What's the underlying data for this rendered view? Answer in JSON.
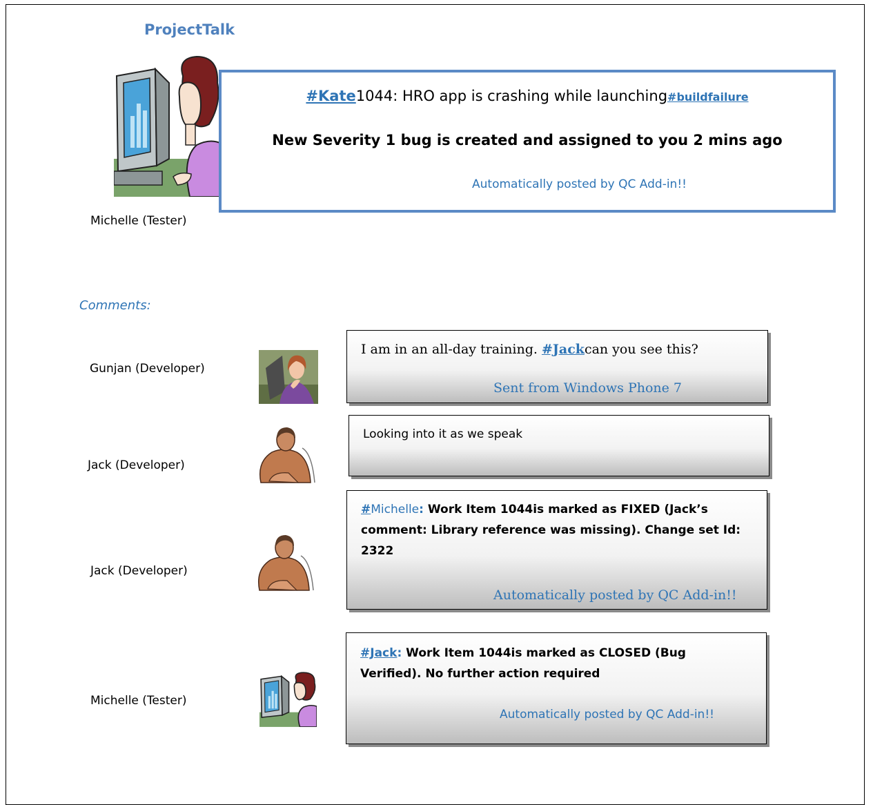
{
  "app": {
    "title": "ProjectTalk"
  },
  "post": {
    "author": "Michelle (Tester)",
    "mention": "#Kate",
    "text": "1044: HRO app is crashing while launching",
    "tag": "#buildfailure",
    "headline": "New Severity 1 bug is created and assigned to you 2 mins ago",
    "footer": "Automatically posted by QC Add-in!!"
  },
  "comments_label": "Comments:",
  "comments": [
    {
      "author": "Gunjan (Developer)",
      "pre": "I am in an all-day training. ",
      "mention": "#Jack",
      "post": "can you see this?",
      "footer": "Sent from Windows Phone 7",
      "avatar": "woman-at-desk-icon"
    },
    {
      "author": "Jack (Developer)",
      "text": "Looking into it as we speak",
      "avatar": "man-at-desk-icon"
    },
    {
      "author": "Jack (Developer)",
      "mention": "#",
      "mention_name": "Michelle",
      "colon": ":",
      "text": " Work Item 1044is marked as FIXED (Jack’s comment: Library reference was missing). Change set Id: 2322",
      "footer": "Automatically posted by QC Add-in!!",
      "avatar": "man-at-desk-icon"
    },
    {
      "author": "Michelle (Tester)",
      "mention": "#Jack",
      "colon": ":",
      "text": " Work Item 1044is marked as CLOSED (Bug Verified). No further action required",
      "footer": "Automatically posted by QC Add-in!!",
      "avatar": "woman-at-computer-icon"
    }
  ]
}
